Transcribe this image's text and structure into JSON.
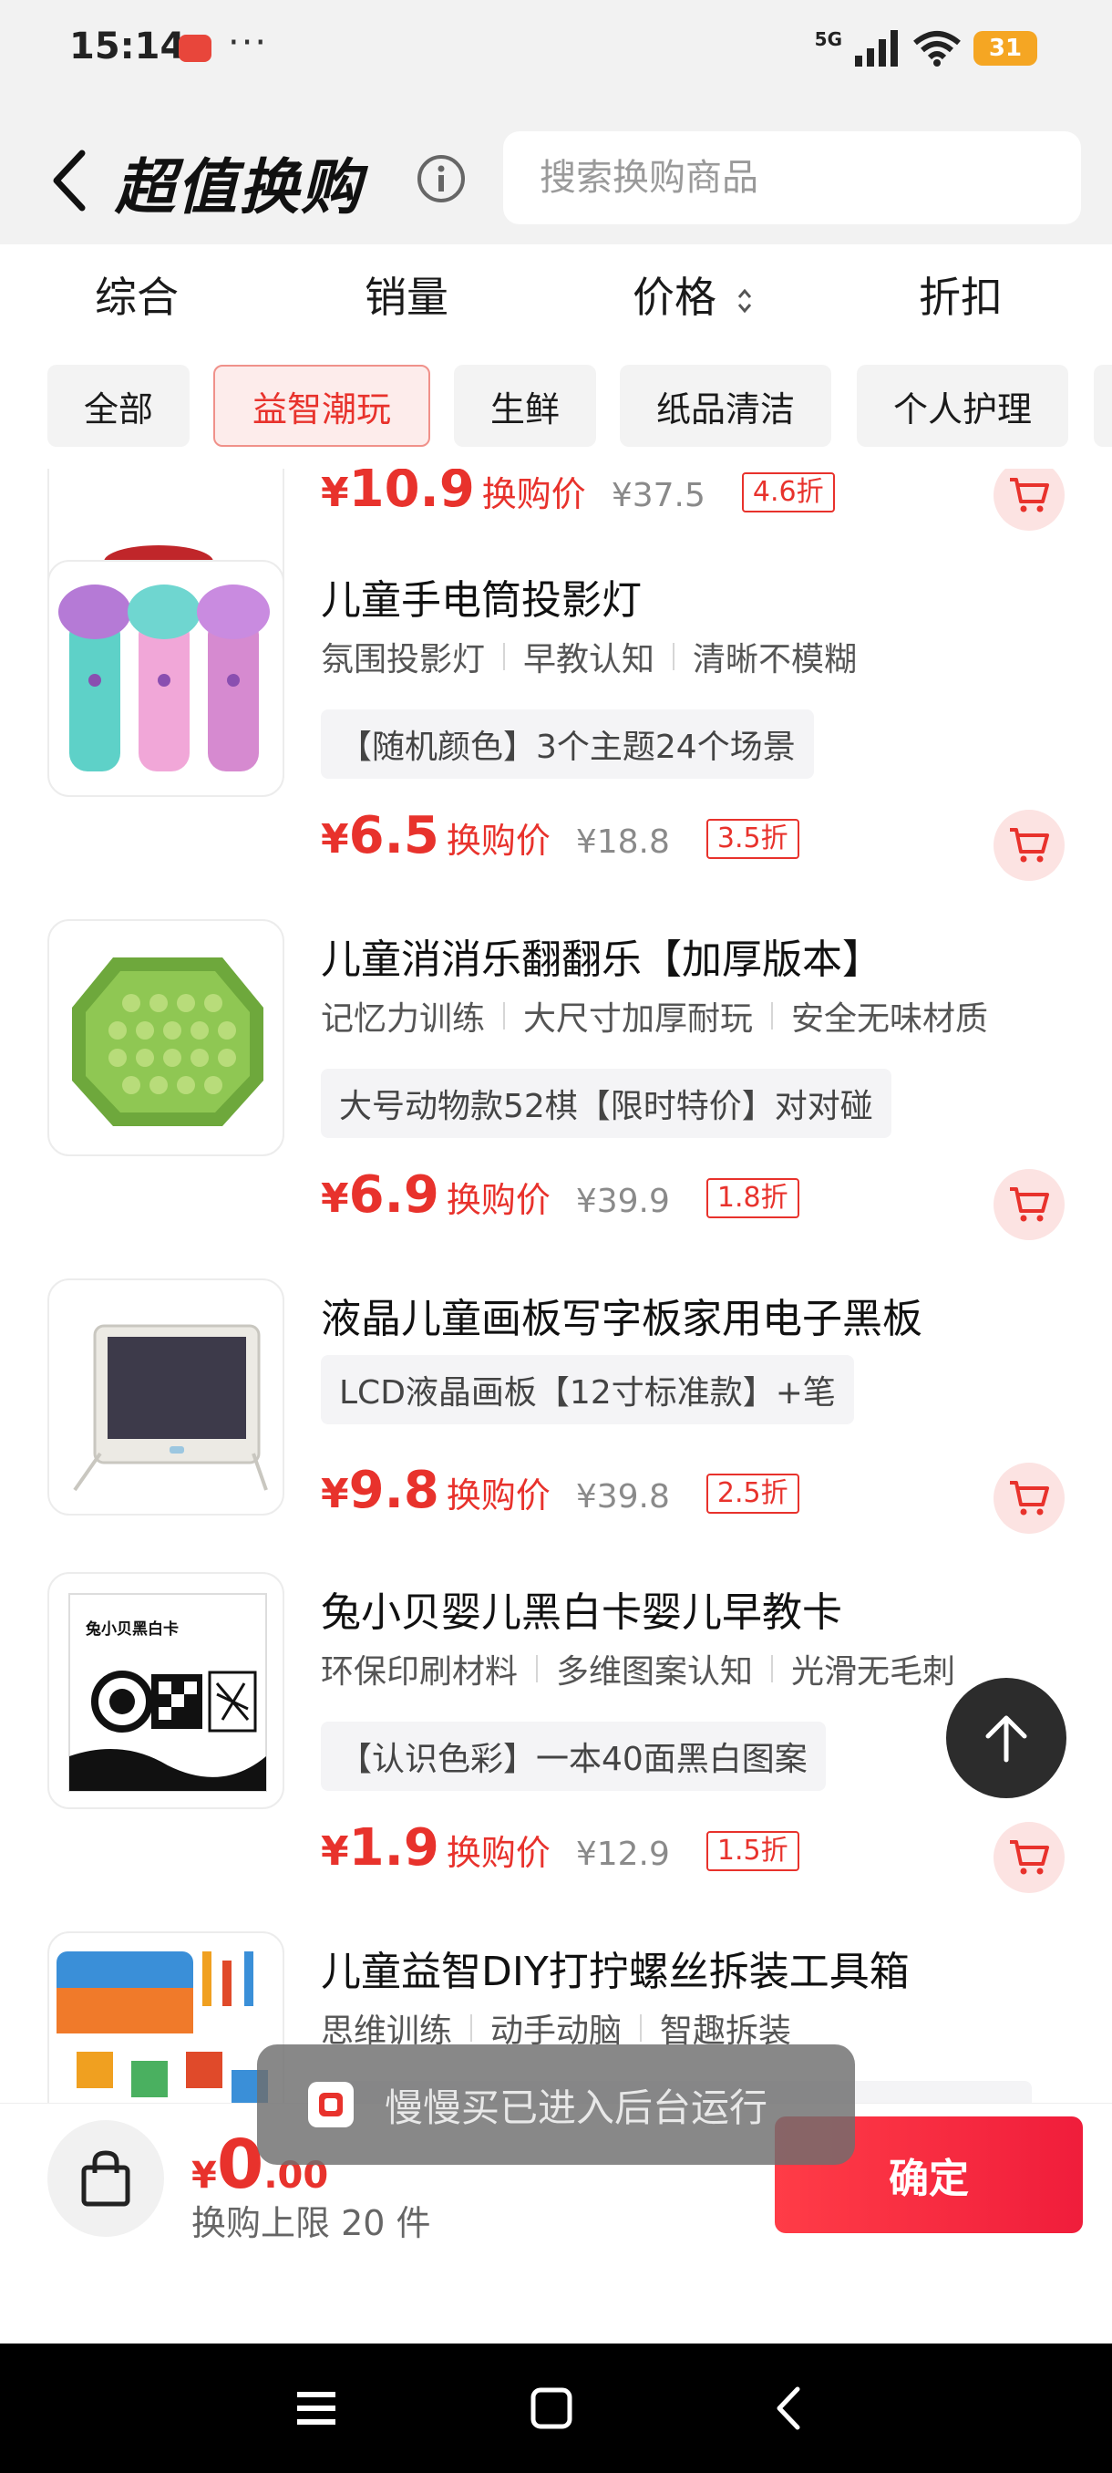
{
  "status_bar": {
    "time": "15:14",
    "dots": "···",
    "network": "5G",
    "battery": "31"
  },
  "header": {
    "title": "超值换购",
    "search_placeholder": "搜索换购商品"
  },
  "sort_tabs": [
    "综合",
    "销量",
    "价格",
    "折扣"
  ],
  "categories": [
    "全部",
    "益智潮玩",
    "生鲜",
    "纸品清洁",
    "个人护理"
  ],
  "active_category": "益智潮玩",
  "price_label": "换购价",
  "currency": "¥",
  "products": [
    {
      "name": "",
      "price": "10.9",
      "original_price": "¥37.5",
      "discount": "4.6折"
    },
    {
      "name": "儿童手电筒投影灯",
      "tags": [
        "氛围投影灯",
        "早教认知",
        "清晰不模糊"
      ],
      "spec": "【随机颜色】3个主题24个场景",
      "price": "6.5",
      "original_price": "¥18.8",
      "discount": "3.5折"
    },
    {
      "name": "儿童消消乐翻翻乐【加厚版本】",
      "tags": [
        "记忆力训练",
        "大尺寸加厚耐玩",
        "安全无味材质"
      ],
      "spec": "大号动物款52棋【限时特价】对对碰",
      "price": "6.9",
      "original_price": "¥39.9",
      "discount": "1.8折"
    },
    {
      "name": "液晶儿童画板写字板家用电子黑板",
      "tags": [],
      "spec": "LCD液晶画板【12寸标准款】+笔",
      "price": "9.8",
      "original_price": "¥39.8",
      "discount": "2.5折"
    },
    {
      "name": "兔小贝婴儿黑白卡婴儿早教卡",
      "tags": [
        "环保印刷材料",
        "多维图案认知",
        "光滑无毛刺"
      ],
      "spec": "【认识色彩】一本40面黑白图案",
      "price": "1.9",
      "original_price": "¥12.9",
      "discount": "1.5折"
    },
    {
      "name": "儿童益智DIY打拧螺丝拆装工具箱",
      "tags": [
        "思维训练",
        "动手动脑",
        "智趣拆装"
      ]
    }
  ],
  "card_box_title": "兔小贝黑白卡",
  "toast": "慢慢买已进入后台运行",
  "bottom": {
    "currency": "¥",
    "total_int": "0",
    "total_dec": ".00",
    "limit": "换购上限 20 件",
    "confirm": "确定"
  }
}
